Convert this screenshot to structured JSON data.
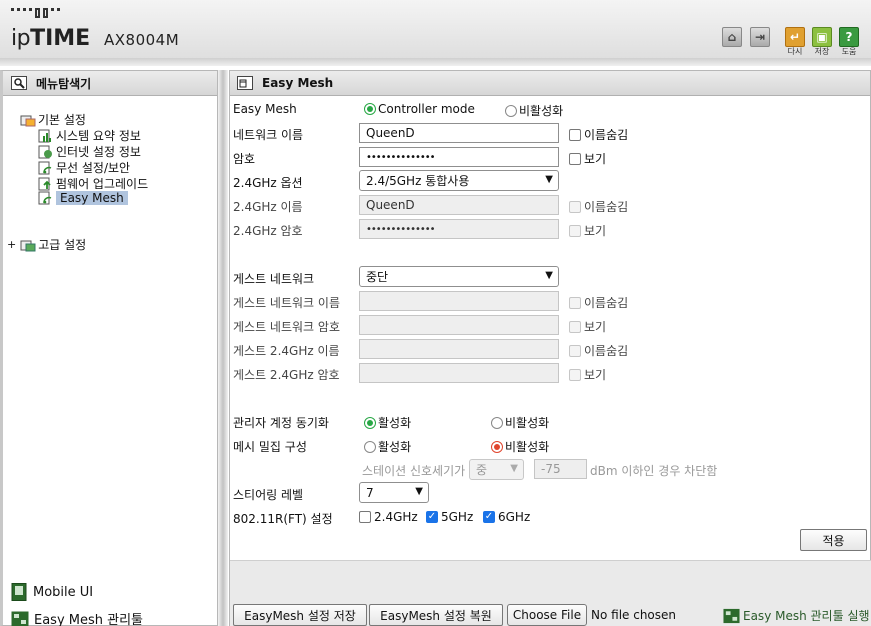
{
  "header": {
    "logo_prefix": "ip",
    "logo_bold": "TIME",
    "model": "AX8004M",
    "buttons": [
      {
        "label": "다시",
        "color": "#e0a030"
      },
      {
        "label": "저장",
        "color": "#8cc040"
      },
      {
        "label": "도움",
        "color": "#3a9a40"
      }
    ]
  },
  "left_panel": {
    "title": "메뉴탐색기",
    "basic_settings": "기본 설정",
    "items": [
      "시스템 요약 정보",
      "인터넷 설정 정보",
      "무선 설정/보안",
      "펌웨어 업그레이드",
      "Easy Mesh"
    ],
    "advanced_settings": "고급 설정",
    "mobile_ui": "Mobile UI",
    "mesh_tool": "Easy Mesh 관리툴"
  },
  "right_panel": {
    "title": "Easy Mesh",
    "easy_mesh": {
      "label": "Easy Mesh",
      "opt_controller": "Controller mode",
      "opt_disable": "비활성화"
    },
    "network_name": {
      "label": "네트워크 이름",
      "value": "QueenD",
      "hide_label": "이름숨김"
    },
    "password": {
      "label": "암호",
      "value": "••••••••••••••",
      "show_label": "보기"
    },
    "ghz24_option": {
      "label": "2.4GHz 옵션",
      "value": "2.4/5GHz 통합사용"
    },
    "ghz24_name": {
      "label": "2.4GHz 이름",
      "value": "QueenD",
      "hide_label": "이름숨김"
    },
    "ghz24_password": {
      "label": "2.4GHz 암호",
      "value": "••••••••••••••",
      "show_label": "보기"
    },
    "guest_network": {
      "label": "게스트 네트워크",
      "value": "중단"
    },
    "guest_name": {
      "label": "게스트 네트워크 이름",
      "hide_label": "이름숨김"
    },
    "guest_password": {
      "label": "게스트 네트워크 암호",
      "show_label": "보기"
    },
    "guest24_name": {
      "label": "게스트 2.4GHz 이름",
      "hide_label": "이름숨김"
    },
    "guest24_password": {
      "label": "게스트 2.4GHz 암호",
      "show_label": "보기"
    },
    "admin_sync": {
      "label": "관리자 계정 동기화",
      "opt_enable": "활성화",
      "opt_disable": "비활성화"
    },
    "mesh_dense": {
      "label": "메시 밀집 구성",
      "opt_enable": "활성화",
      "opt_disable": "비활성화"
    },
    "station_signal": {
      "label": "스테이션 신호세기가",
      "level": "중",
      "dbm": "-75",
      "suffix": "dBm 이하인 경우 차단함"
    },
    "steering": {
      "label": "스티어링 레벨",
      "value": "7"
    },
    "ft": {
      "label": "802.11R(FT) 설정",
      "opt_24": "2.4GHz",
      "opt_5": "5GHz",
      "opt_6": "6GHz"
    },
    "apply": "적용"
  },
  "bottom": {
    "save_btn": "EasyMesh 설정 저장",
    "restore_btn": "EasyMesh 설정 복원",
    "choose_file": "Choose File",
    "no_file": "No file chosen",
    "run_tool": "Easy Mesh 관리툴 실행"
  }
}
